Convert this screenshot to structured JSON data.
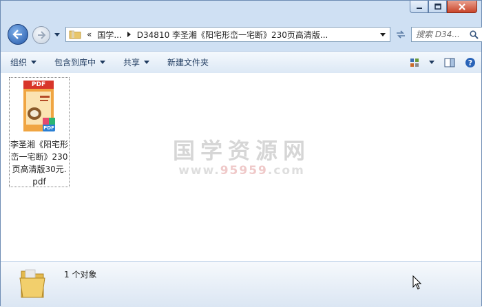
{
  "window": {
    "caption": {
      "minimize_icon": "minimize-icon",
      "maximize_icon": "maximize-icon",
      "close_icon": "close-icon"
    }
  },
  "address_bar": {
    "overflow": "«",
    "segments": [
      "国学...",
      "D34810 李圣湘《阳宅形峦一宅断》230页高清版..."
    ]
  },
  "search": {
    "placeholder": "搜索 D34..."
  },
  "toolbar": {
    "organize": "组织",
    "include_in_library": "包含到库中",
    "share": "共享",
    "new_folder": "新建文件夹"
  },
  "file": {
    "name": "李圣湘《阳宅形峦一宅断》230页高清版30元.pdf",
    "thumb_label": "PDF",
    "badge": "PDF"
  },
  "watermark": {
    "main": "国学资源网",
    "sub_prefix": "www.",
    "sub_number": "95959",
    "sub_suffix": ".com"
  },
  "status": {
    "text": "1 个对象"
  },
  "colors": {
    "accent": "#2458a8",
    "pdf_red": "#d8352a",
    "pdf_orange": "#f29b2b"
  }
}
